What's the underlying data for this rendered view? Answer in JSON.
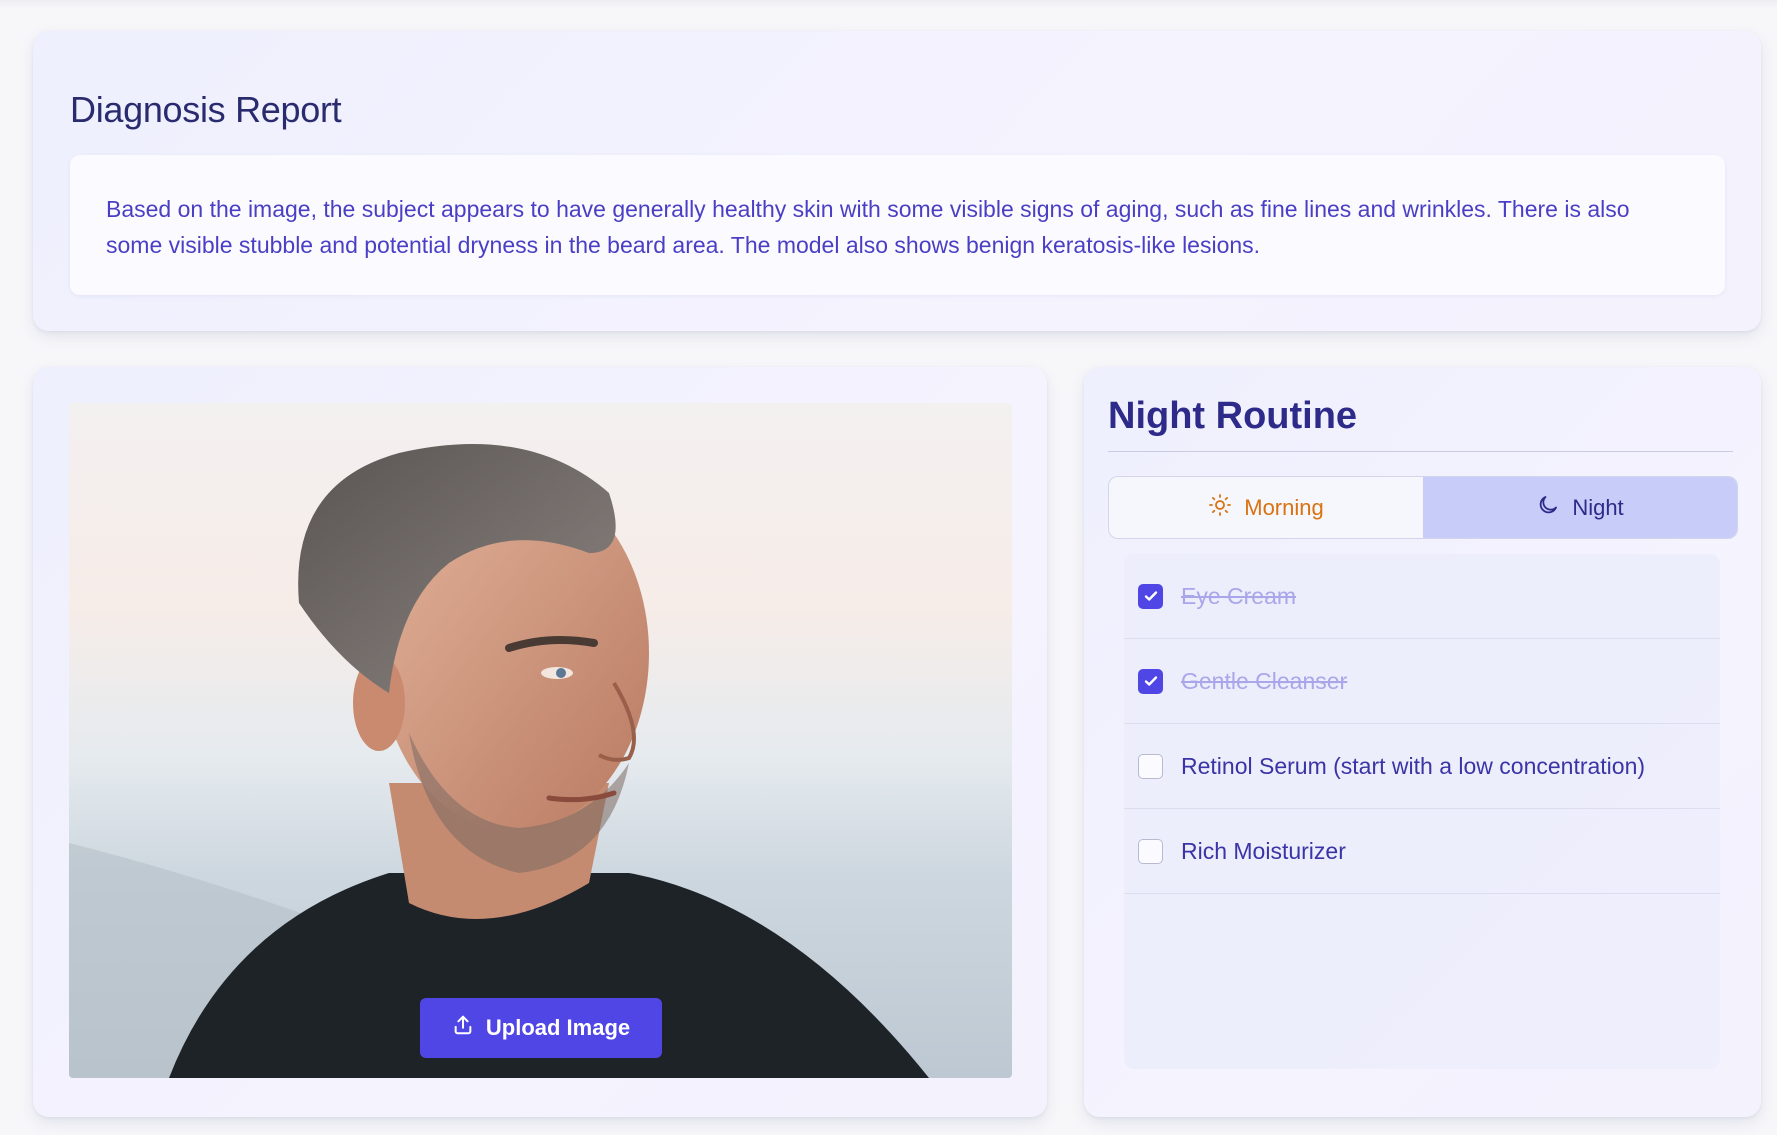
{
  "report": {
    "title": "Diagnosis Report",
    "text": "Based on the image, the subject appears to have generally healthy skin with some visible signs of aging, such as fine lines and wrinkles. There is also some visible stubble and potential dryness in the beard area. The model also shows benign keratosis-like lesions."
  },
  "upload": {
    "label": "Upload Image",
    "icon": "upload-icon"
  },
  "routine": {
    "title": "Night Routine",
    "tabs": [
      {
        "label": "Morning",
        "icon": "sun-icon",
        "active": false
      },
      {
        "label": "Night",
        "icon": "moon-icon",
        "active": true
      }
    ],
    "tasks": [
      {
        "label": "Eye Cream",
        "checked": true
      },
      {
        "label": "Gentle Cleanser",
        "checked": true
      },
      {
        "label": "Retinol Serum (start with a low concentration)",
        "checked": false
      },
      {
        "label": "Rich Moisturizer",
        "checked": false
      }
    ]
  },
  "colors": {
    "accent": "#4f46e5",
    "title": "#2e2a8a",
    "morning": "#d9720f",
    "active_tab": "#c7cdf8"
  }
}
